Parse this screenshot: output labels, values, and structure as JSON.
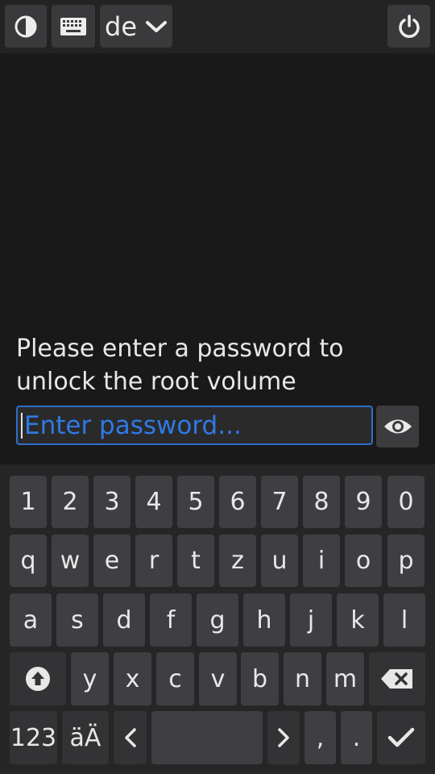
{
  "topbar": {
    "theme_icon": "contrast-icon",
    "keyboard_icon": "keyboard-icon",
    "layout_label": "de",
    "power_icon": "power-icon"
  },
  "prompt": {
    "message": "Please enter a password to unlock the root volume"
  },
  "password": {
    "placeholder": "Enter password...",
    "value": "",
    "reveal_icon": "eye-icon"
  },
  "keyboard": {
    "row1": [
      "1",
      "2",
      "3",
      "4",
      "5",
      "6",
      "7",
      "8",
      "9",
      "0"
    ],
    "row2": [
      "q",
      "w",
      "e",
      "r",
      "t",
      "z",
      "u",
      "i",
      "o",
      "p"
    ],
    "row3": [
      "a",
      "s",
      "d",
      "f",
      "g",
      "h",
      "j",
      "k",
      "l"
    ],
    "row4": [
      "y",
      "x",
      "c",
      "v",
      "b",
      "n",
      "m"
    ],
    "shift_icon": "shift-icon",
    "backspace_icon": "backspace-icon",
    "numbers_label": "123",
    "umlaut_label": "äÄ",
    "left_icon": "chevron-left-icon",
    "space_label": "",
    "right_icon": "chevron-right-icon",
    "comma_label": ",",
    "period_label": ".",
    "enter_icon": "checkmark-icon"
  },
  "colors": {
    "background": "#191919",
    "accent": "#2f7ae5",
    "key": "#3f3f43"
  }
}
